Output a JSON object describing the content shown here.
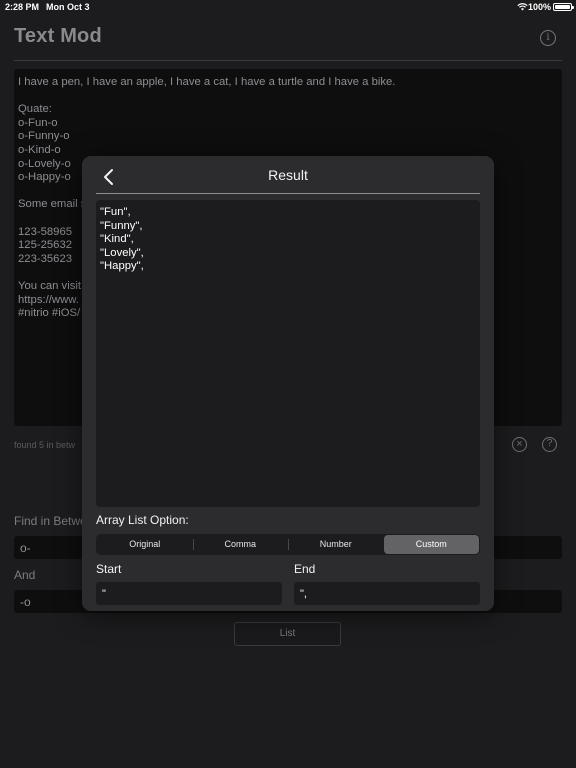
{
  "status_bar": {
    "time": "2:28 PM",
    "date": "Mon Oct 3",
    "battery": "100%"
  },
  "app": {
    "title": "Text Mod",
    "info_icon": "info-icon"
  },
  "editor": {
    "lines": [
      "I have a pen, I have an apple, I have a cat, I have a turtle and I have a bike.",
      "",
      "Quate:",
      "o-Fun-o",
      "o-Funny-o",
      "o-Kind-o",
      "o-Lovely-o",
      "o-Happy-o",
      "",
      "Some email s",
      "",
      "123-58965",
      "125-25632",
      "223-35623",
      "",
      "You can visit",
      "https://www.",
      "#nitrio #iOS/"
    ]
  },
  "found_text": "found 5 in betw",
  "find_label": "Find in Betwe",
  "find_value": "o-",
  "and_label": "And",
  "and_value": "-o",
  "list_button": "List",
  "modal": {
    "title": "Result",
    "result_lines": [
      "\"Fun\",",
      "\"Funny\",",
      "\"Kind\",",
      "\"Lovely\",",
      "\"Happy\","
    ],
    "array_option_label": "Array List Option:",
    "options": [
      "Original",
      "Comma",
      "Number",
      "Custom"
    ],
    "selected_option": "Custom",
    "start_label": "Start",
    "start_value": "\"",
    "end_label": "End",
    "end_value": "\","
  },
  "colors": {
    "background": "#1c1c1e",
    "modal": "#2c2c2e",
    "selected_segment": "#636366"
  }
}
